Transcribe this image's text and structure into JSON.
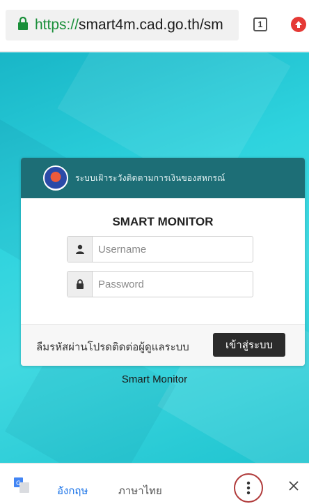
{
  "browser": {
    "url_scheme": "https://",
    "url_host": "smart4m.cad.go.th/sm",
    "tab_count": "1"
  },
  "login_card": {
    "header_title": "ระบบเฝ้าระวังติดตามการเงินของสหกรณ์",
    "app_title": "SMART MONITOR",
    "username_placeholder": "Username",
    "password_placeholder": "Password",
    "forgot_text": "ลืมรหัสผ่านโปรดติดต่อผู้ดูแลระบบ",
    "login_button": "เข้าสู่ระบบ"
  },
  "page": {
    "footer_caption": "Smart Monitor"
  },
  "translate_bar": {
    "lang_source": "อังกฤษ",
    "lang_target": "ภาษาไทย"
  },
  "colors": {
    "accent_teal": "#1d6e76",
    "background_cyan": "#2ed3de",
    "link_blue": "#1a73e8",
    "highlight_circle": "#b03a3a"
  }
}
